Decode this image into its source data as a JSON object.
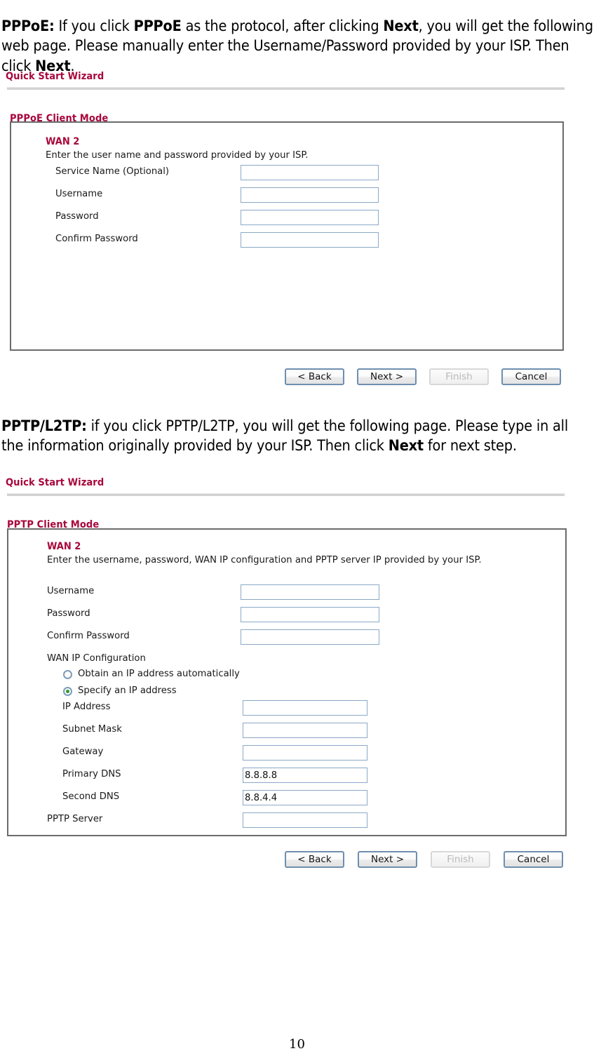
{
  "page": {
    "number": "10"
  },
  "paragraphs": {
    "pppoe": {
      "lead": "PPPoE:",
      "parts": [
        {
          "text": " If you click ",
          "bold": false
        },
        {
          "text": "PPPoE",
          "bold": true
        },
        {
          "text": " as the protocol, after clicking ",
          "bold": false
        },
        {
          "text": "Next",
          "bold": true
        },
        {
          "text": ", you will get the following web page. Please manually enter the Username/Password provided by your ISP. Then click ",
          "bold": false
        },
        {
          "text": "Next",
          "bold": true
        },
        {
          "text": ".",
          "bold": false
        }
      ]
    },
    "pptp": {
      "lead": "PPTP/L2TP:",
      "parts": [
        {
          "text": " if you click PPTP/L2TP, you will get the following page. Please type in all the information originally provided by your ISP. Then click ",
          "bold": false
        },
        {
          "text": "Next",
          "bold": true
        },
        {
          "text": " for next step.",
          "bold": false
        }
      ]
    }
  },
  "pppoe_section": {
    "wizard_title": "Quick Start Wizard",
    "mode_title": "PPPoE Client Mode",
    "wan_label": "WAN 2",
    "hint": "Enter the user name and password provided by your ISP.",
    "fields": [
      {
        "label": "Service Name (Optional)",
        "value": "",
        "placeholder": ""
      },
      {
        "label": "Username",
        "value": "",
        "placeholder": ""
      },
      {
        "label": "Password",
        "value": "",
        "placeholder": ""
      },
      {
        "label": "Confirm Password",
        "value": "",
        "placeholder": ""
      }
    ],
    "buttons": [
      {
        "label": "< Back",
        "disabled": false
      },
      {
        "label": "Next >",
        "disabled": false
      },
      {
        "label": "Finish",
        "disabled": true
      },
      {
        "label": "Cancel",
        "disabled": false
      }
    ]
  },
  "pptp_section": {
    "wizard_title": "Quick Start Wizard",
    "mode_title": "PPTP Client Mode",
    "wan_label": "WAN 2",
    "hint": "Enter the username, password, WAN IP configuration and PPTP server IP provided by your ISP.",
    "fields_top": [
      {
        "label": "Username",
        "value": "",
        "placeholder": ""
      },
      {
        "label": "Password",
        "value": "",
        "placeholder": ""
      },
      {
        "label": "Confirm Password",
        "value": "",
        "placeholder": ""
      }
    ],
    "wan_ip_config_label": "WAN IP Configuration",
    "radios": [
      {
        "label": "Obtain an IP address automatically",
        "checked": false
      },
      {
        "label": "Specify an IP address",
        "checked": true
      }
    ],
    "fields_ip": [
      {
        "label": "IP Address",
        "value": "",
        "placeholder": ""
      },
      {
        "label": "Subnet Mask",
        "value": "",
        "placeholder": ""
      },
      {
        "label": "Gateway",
        "value": "",
        "placeholder": ""
      },
      {
        "label": "Primary DNS",
        "value": "8.8.8.8",
        "placeholder": ""
      },
      {
        "label": "Second DNS",
        "value": "8.8.4.4",
        "placeholder": ""
      }
    ],
    "pptp_server": {
      "label": "PPTP Server",
      "value": "",
      "placeholder": ""
    },
    "buttons": [
      {
        "label": "< Back",
        "disabled": false
      },
      {
        "label": "Next >",
        "disabled": false
      },
      {
        "label": "Finish",
        "disabled": true
      },
      {
        "label": "Cancel",
        "disabled": false
      }
    ]
  },
  "colors": {
    "heading": "#A8073C",
    "panel_border": "#6b6b6b",
    "input_border": "#8ba8c6",
    "button_border": "#6f8fb0",
    "radio_selected": "#2e9b2e",
    "rule": "#d2d2d2"
  }
}
